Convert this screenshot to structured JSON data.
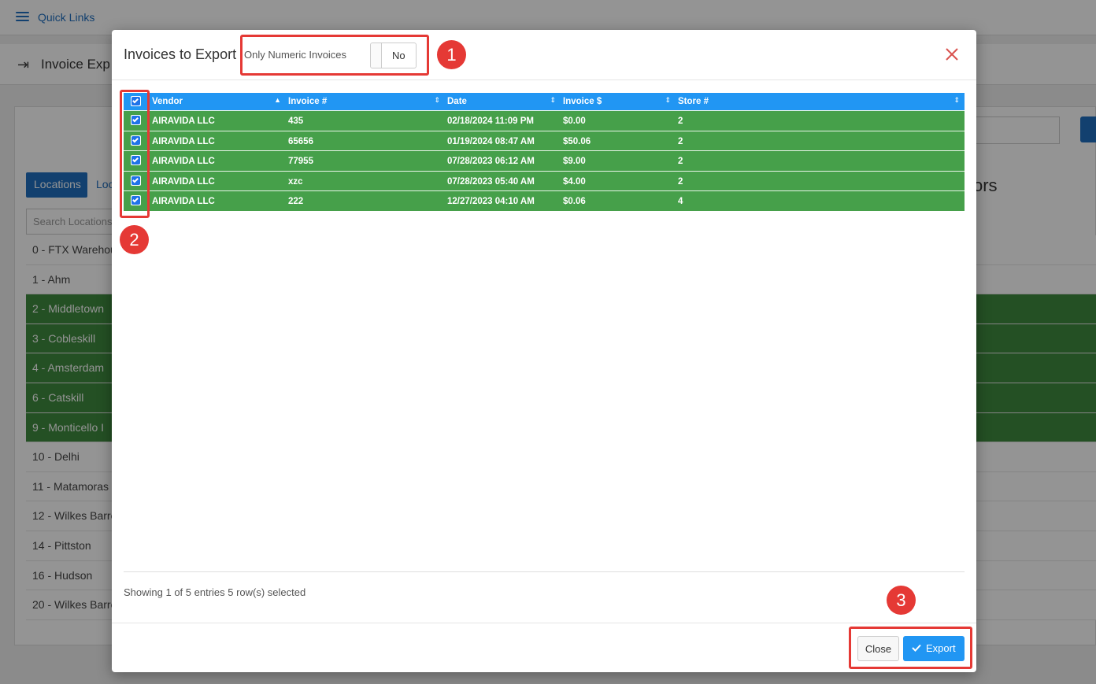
{
  "background": {
    "quick_links": "Quick Links",
    "page_title": "Invoice Exp",
    "tabs": [
      "Locations",
      "Loc"
    ],
    "search_placeholder": "Search Locations",
    "right_heading": "ors",
    "locations": [
      {
        "label": "0 - FTX Warehous",
        "selected": false
      },
      {
        "label": "1 - Ahm",
        "selected": false
      },
      {
        "label": "2 - Middletown",
        "selected": true
      },
      {
        "label": "3 - Cobleskill",
        "selected": true
      },
      {
        "label": "4 - Amsterdam",
        "selected": true
      },
      {
        "label": "6 - Catskill",
        "selected": true
      },
      {
        "label": "9 - Monticello I",
        "selected": true
      },
      {
        "label": "10 - Delhi",
        "selected": false
      },
      {
        "label": "11 - Matamoras",
        "selected": false
      },
      {
        "label": "12 - Wilkes Barre",
        "selected": false
      },
      {
        "label": "14 - Pittston",
        "selected": false
      },
      {
        "label": "16 - Hudson",
        "selected": false
      },
      {
        "label": "20 - Wilkes Barre",
        "selected": false
      }
    ]
  },
  "modal": {
    "title": "Invoices to Export",
    "numeric_label": "Only Numeric Invoices",
    "numeric_value": "No",
    "columns": [
      "Vendor",
      "Invoice #",
      "Date",
      "Invoice $",
      "Store #"
    ],
    "rows": [
      {
        "vendor": "AIRAVIDA LLC",
        "invoice": "435",
        "date": "02/18/2024 11:09 PM",
        "amount": "$0.00",
        "store": "2"
      },
      {
        "vendor": "AIRAVIDA LLC",
        "invoice": "65656",
        "date": "01/19/2024 08:47 AM",
        "amount": "$50.06",
        "store": "2"
      },
      {
        "vendor": "AIRAVIDA LLC",
        "invoice": "77955",
        "date": "07/28/2023 06:12 AM",
        "amount": "$9.00",
        "store": "2"
      },
      {
        "vendor": "AIRAVIDA LLC",
        "invoice": "xzc",
        "date": "07/28/2023 05:40 AM",
        "amount": "$4.00",
        "store": "2"
      },
      {
        "vendor": "AIRAVIDA LLC",
        "invoice": "222",
        "date": "12/27/2023 04:10 AM",
        "amount": "$0.06",
        "store": "4"
      }
    ],
    "status": "Showing 1 of 5 entries 5 row(s) selected",
    "close_label": "Close",
    "export_label": "Export"
  },
  "annotations": [
    "1",
    "2",
    "3"
  ],
  "colors": {
    "header_blue": "#2196f3",
    "row_green": "#46a04a",
    "annotation_red": "#e53935"
  }
}
